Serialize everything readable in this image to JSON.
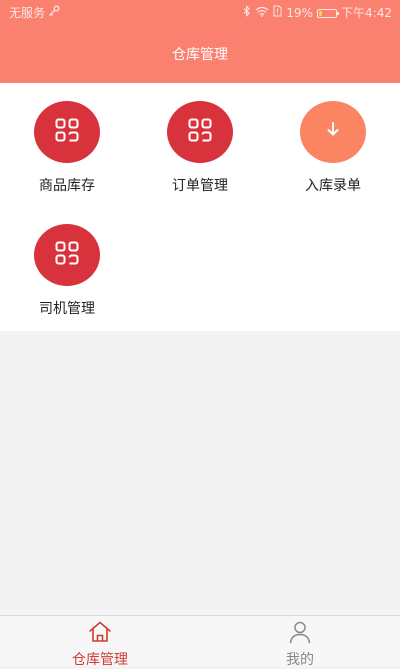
{
  "status_bar": {
    "carrier": "无服务",
    "battery_percent": "19%",
    "battery_level": 0.19,
    "time": "下午4:42",
    "icons": [
      "key-icon",
      "bluetooth-icon",
      "wifi-icon",
      "sim-icon",
      "battery-icon"
    ]
  },
  "header": {
    "title": "仓库管理"
  },
  "menu": {
    "items": [
      {
        "label": "商品库存",
        "icon": "grid-icon",
        "color": "#d8323d"
      },
      {
        "label": "订单管理",
        "icon": "grid-icon",
        "color": "#d8323d"
      },
      {
        "label": "入库录单",
        "icon": "arrow-down-icon",
        "color": "#fb8562"
      },
      {
        "label": "司机管理",
        "icon": "grid-icon",
        "color": "#d8323d"
      }
    ]
  },
  "tabbar": {
    "tabs": [
      {
        "label": "仓库管理",
        "icon": "home-icon",
        "active": true
      },
      {
        "label": "我的",
        "icon": "person-icon",
        "active": false
      }
    ]
  },
  "colors": {
    "header_bg": "#fa8070",
    "accent_red": "#d8323d",
    "accent_orange": "#fb8562",
    "tab_active": "#d23b34",
    "tab_inactive": "#888888"
  }
}
